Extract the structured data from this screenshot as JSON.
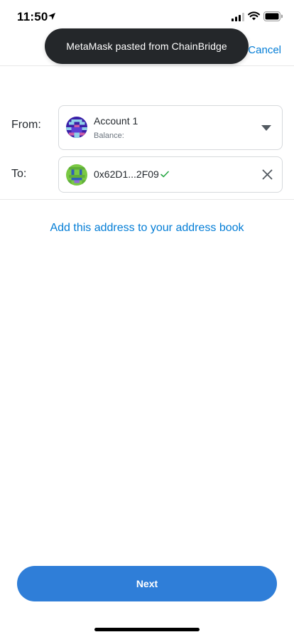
{
  "status_bar": {
    "time": "11:50",
    "icons": [
      "location-arrow-icon",
      "signal-icon",
      "wifi-icon",
      "battery-icon"
    ]
  },
  "header": {
    "cancel_label": "Cancel"
  },
  "toast": {
    "message": "MetaMask pasted from ChainBridge"
  },
  "from": {
    "label": "From:",
    "account_name": "Account 1",
    "balance_label": "Balance:"
  },
  "to": {
    "label": "To:",
    "address": "0x62D1...2F09"
  },
  "address_book_link": "Add this address to your address book",
  "next_button": "Next",
  "colors": {
    "link_blue": "#037dd6",
    "button_blue": "#2f7ed8",
    "toast_bg": "#24272a",
    "valid_green": "#28a745"
  }
}
